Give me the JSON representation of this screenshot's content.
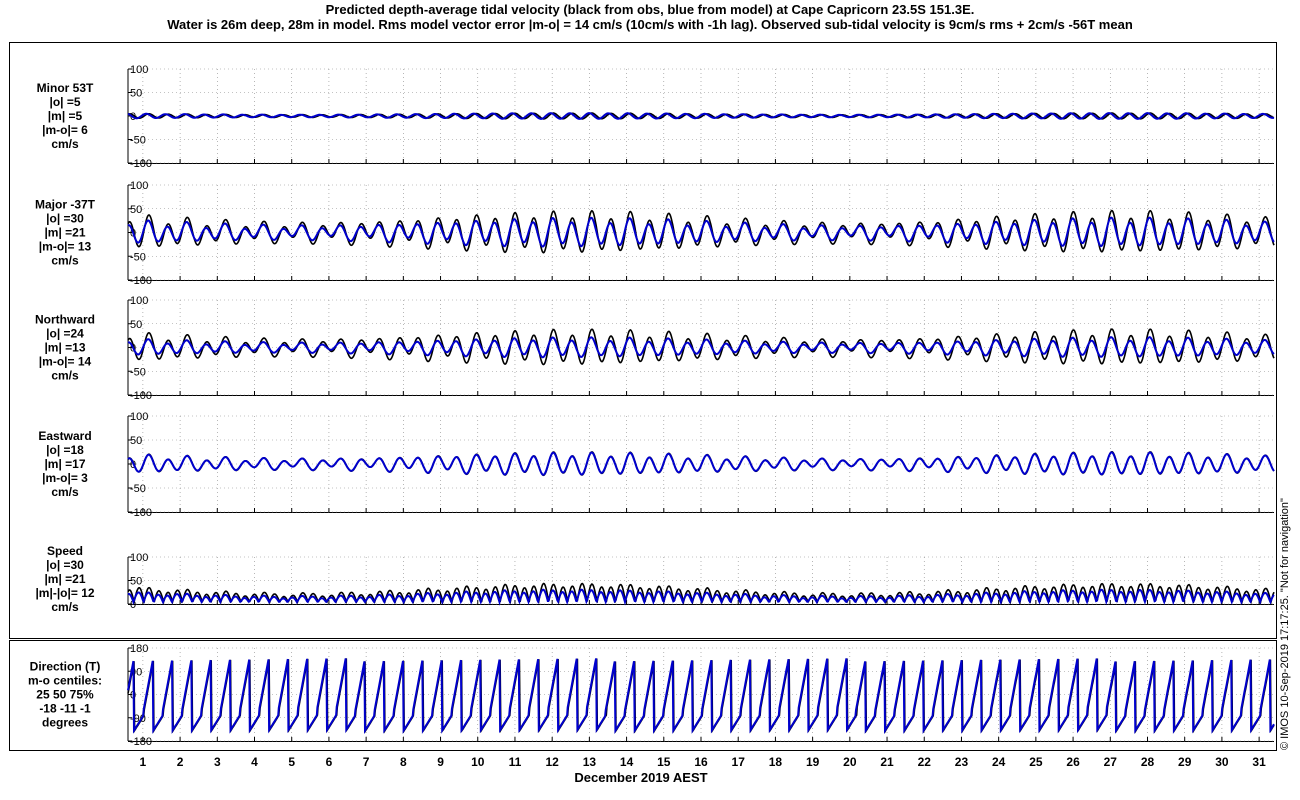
{
  "title": {
    "line1": "Predicted depth-average tidal velocity (black from obs, blue from model) at Cape Capricorn 23.5S 151.3E.",
    "line2": "Water is 26m deep, 28m in model. Rms model vector error |m-o| = 14 cm/s (10cm/s with -1h lag). Observed sub-tidal velocity is 9cm/s rms + 2cm/s -56T mean"
  },
  "side_note": "© IMOS 10-Sep-2019 17:17:25. \"Not for navigation\"",
  "colors": {
    "obs": "#000000",
    "model": "#0000cc",
    "grid": "#888888",
    "axis": "#000000"
  },
  "chart_data": {
    "type": "line",
    "xlabel": "December 2019 AEST",
    "x_ticks": [
      "1",
      "2",
      "3",
      "4",
      "5",
      "6",
      "7",
      "8",
      "9",
      "10",
      "11",
      "12",
      "13",
      "14",
      "15",
      "16",
      "17",
      "18",
      "19",
      "20",
      "21",
      "22",
      "23",
      "24",
      "25",
      "26",
      "27",
      "28",
      "29",
      "30",
      "31"
    ],
    "xlim": [
      0.6,
      31.4
    ],
    "grid": true,
    "series": [
      {
        "name": "obs"
      },
      {
        "name": "model"
      }
    ],
    "panels": [
      {
        "label_lines": [
          "Minor 53T",
          "|o| =5",
          "|m| =5",
          "|m-o|= 6",
          "cm/s"
        ],
        "yticks": [
          "100",
          "50",
          "0",
          "-50",
          "-100"
        ],
        "ylim": [
          -100,
          100
        ],
        "kind": "velocity",
        "obs_amp": 6,
        "model_amp": 6,
        "phase_shift": 0.9
      },
      {
        "label_lines": [
          "Major -37T",
          "|o| =30",
          "|m| =21",
          "|m-o|= 13",
          "cm/s"
        ],
        "yticks": [
          "100",
          "50",
          "0",
          "-50",
          "-100"
        ],
        "ylim": [
          -100,
          100
        ],
        "kind": "velocity",
        "obs_amp": 38,
        "model_amp": 26,
        "phase_shift": 0.25
      },
      {
        "label_lines": [
          "Northward",
          "|o| =24",
          "|m| =13",
          "|m-o|= 14",
          "cm/s"
        ],
        "yticks": [
          "100",
          "50",
          "0",
          "-50",
          "-100"
        ],
        "ylim": [
          -100,
          100
        ],
        "kind": "velocity",
        "obs_amp": 32,
        "model_amp": 18,
        "phase_shift": 0.25
      },
      {
        "label_lines": [
          "Eastward",
          "|o| =18",
          "|m| =17",
          "|m-o|= 3",
          "cm/s"
        ],
        "yticks": [
          "100",
          "50",
          "0",
          "-50",
          "-100"
        ],
        "ylim": [
          -100,
          100
        ],
        "kind": "velocity",
        "obs_amp": 21,
        "model_amp": 20,
        "phase_shift": 0.08
      },
      {
        "label_lines": [
          "Speed",
          "|o| =30",
          "|m| =21",
          "|m|-|o|= 12",
          "cm/s"
        ],
        "yticks": [
          "100",
          "50",
          "0"
        ],
        "ylim": [
          0,
          100
        ],
        "kind": "speed",
        "obs_amp": 36,
        "model_amp": 24,
        "phase_shift": 0.2
      },
      {
        "label_lines": [
          "Direction (T)",
          "m-o centiles:",
          "25  50  75%",
          "-18 -11  -1",
          "degrees"
        ],
        "yticks": [
          "180",
          "90",
          "0",
          "-90",
          "-180"
        ],
        "ylim": [
          -180,
          180
        ],
        "kind": "direction",
        "obs_amp": 0,
        "model_amp": 0,
        "phase_shift": 0.2
      }
    ]
  }
}
